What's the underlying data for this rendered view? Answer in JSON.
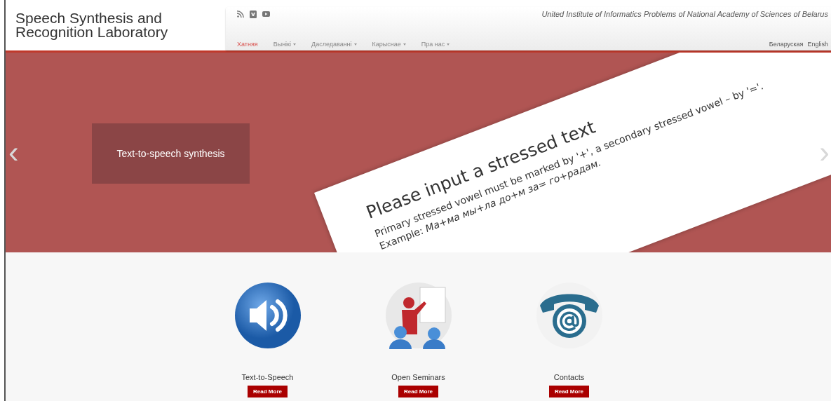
{
  "logo": {
    "lines": [
      "Speech Synthesis and",
      "Recognition Laboratory"
    ]
  },
  "social": [
    {
      "kind": "rss"
    },
    {
      "kind": "vk"
    },
    {
      "kind": "youtube"
    }
  ],
  "institute": "United Institute of Informatics Problems of National Academy of Sciences of Belarus",
  "menu": [
    {
      "label": "Хатняя",
      "selected": true,
      "has_menu": false
    },
    {
      "label": "Вынікі",
      "selected": false,
      "has_menu": true
    },
    {
      "label": "Даследаванні",
      "selected": false,
      "has_menu": true
    },
    {
      "label": "Карыснае",
      "selected": false,
      "has_menu": true
    },
    {
      "label": "Пра нас",
      "selected": false,
      "has_menu": true
    }
  ],
  "languages": [
    "Беларуская",
    "English"
  ],
  "carousel": {
    "prev": "‹",
    "next": "›",
    "caption": "Text-to-speech synthesis",
    "slide": {
      "heading": "Please input a stressed text",
      "lines": [
        "Primary stressed vowel must be marked by '+', a secondary stressed vowel – by '='.",
        "Example: *Ма+ма мы+ла до+м за= го+радам.*"
      ]
    }
  },
  "features": [
    {
      "kind": "speaker",
      "title": "Text-to-Speech",
      "button": "Read More"
    },
    {
      "kind": "seminar",
      "title": "Open Seminars",
      "button": "Read More"
    },
    {
      "kind": "contacts",
      "title": "Contacts",
      "button": "Read More"
    }
  ]
}
